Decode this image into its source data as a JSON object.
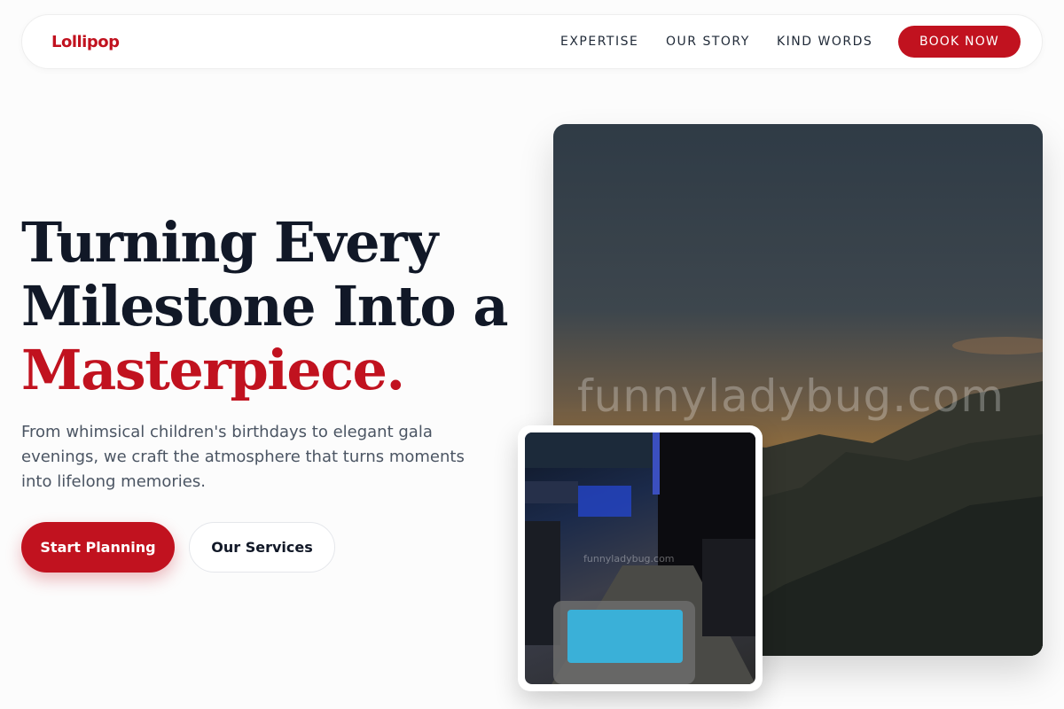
{
  "nav": {
    "logo": "Lollipop",
    "links": [
      {
        "label": "EXPERTISE"
      },
      {
        "label": "OUR STORY"
      },
      {
        "label": "KIND WORDS"
      }
    ],
    "cta": "BOOK NOW"
  },
  "hero": {
    "title_line1": "Turning Every",
    "title_line2": "Milestone Into a",
    "title_accent": "Masterpiece.",
    "subtitle": "From whimsical children's birthdays to elegant gala evenings, we craft the atmosphere that turns moments into lifelong memories.",
    "primary_button": "Start Planning",
    "secondary_button": "Our Services",
    "image_watermark": "funnyladybug.com",
    "inset_watermark": "funnyladybug.com"
  },
  "colors": {
    "accent": "#c1121f",
    "text_dark": "#111827",
    "text_muted": "#4b5563"
  }
}
